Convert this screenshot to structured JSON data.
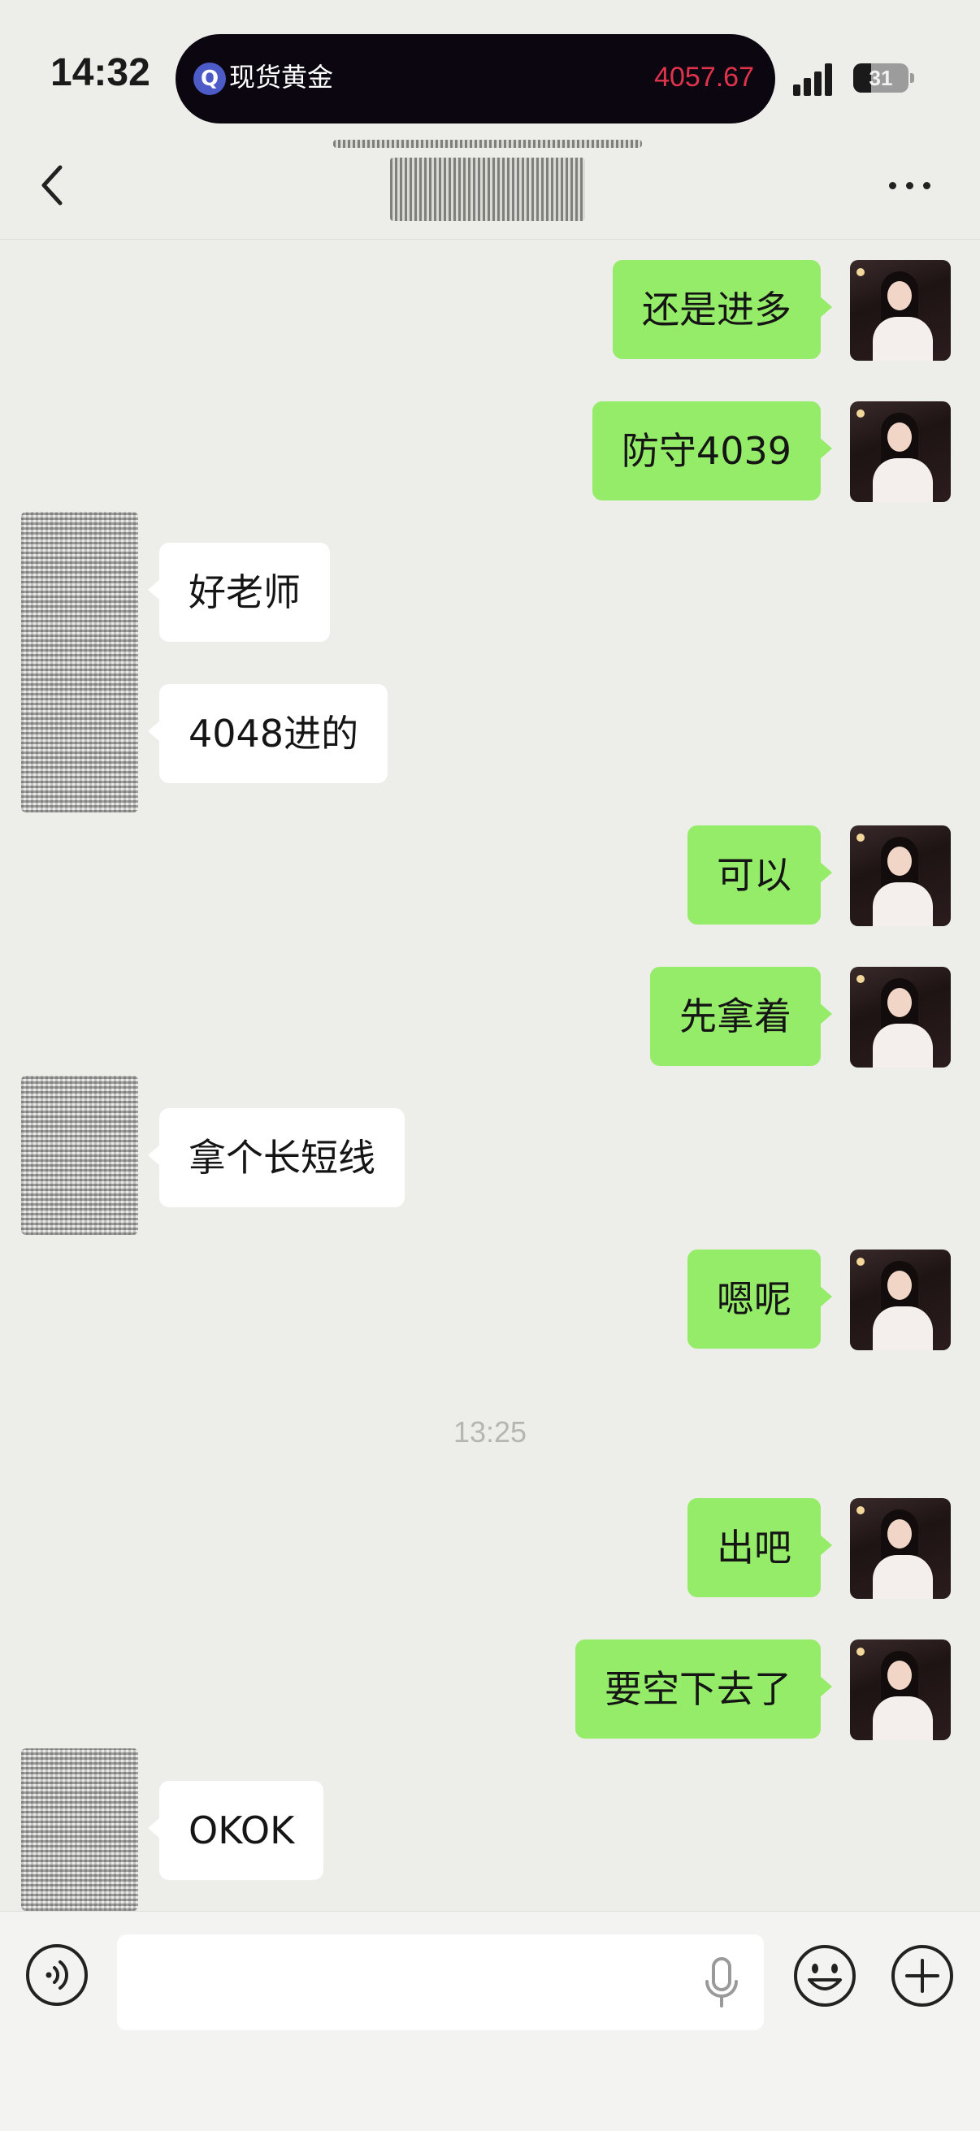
{
  "status_bar": {
    "time": "14:32",
    "island_logo": "Q",
    "island_title": "现货黄金",
    "island_price": "4057.67",
    "battery": "31",
    "icons": [
      "signal-icon",
      "battery-icon"
    ]
  },
  "nav": {
    "back_icon": "chevron-left-icon",
    "more_icon": "more-dots-icon"
  },
  "messages": [
    {
      "side": "sent",
      "text": "还是进多"
    },
    {
      "side": "sent",
      "text": "防守4039"
    },
    {
      "side": "recv",
      "text": "好老师"
    },
    {
      "side": "recv",
      "text": "4048进的"
    },
    {
      "side": "sent",
      "text": "可以"
    },
    {
      "side": "sent",
      "text": "先拿着"
    },
    {
      "side": "recv",
      "text": "拿个长短线"
    },
    {
      "side": "sent",
      "text": "嗯呢"
    },
    {
      "side": "sent",
      "text": "出吧"
    },
    {
      "side": "sent",
      "text": "要空下去了"
    },
    {
      "side": "recv",
      "text": "OKOK"
    }
  ],
  "timestamp": "13:25",
  "input_bar": {
    "placeholder": "",
    "icons": [
      "voice-icon",
      "mic-icon",
      "emoji-icon",
      "plus-icon"
    ]
  },
  "colors": {
    "background": "#edeeea",
    "sent_bubble": "#95ec69",
    "received_bubble": "#ffffff",
    "price": "#e0334c"
  }
}
